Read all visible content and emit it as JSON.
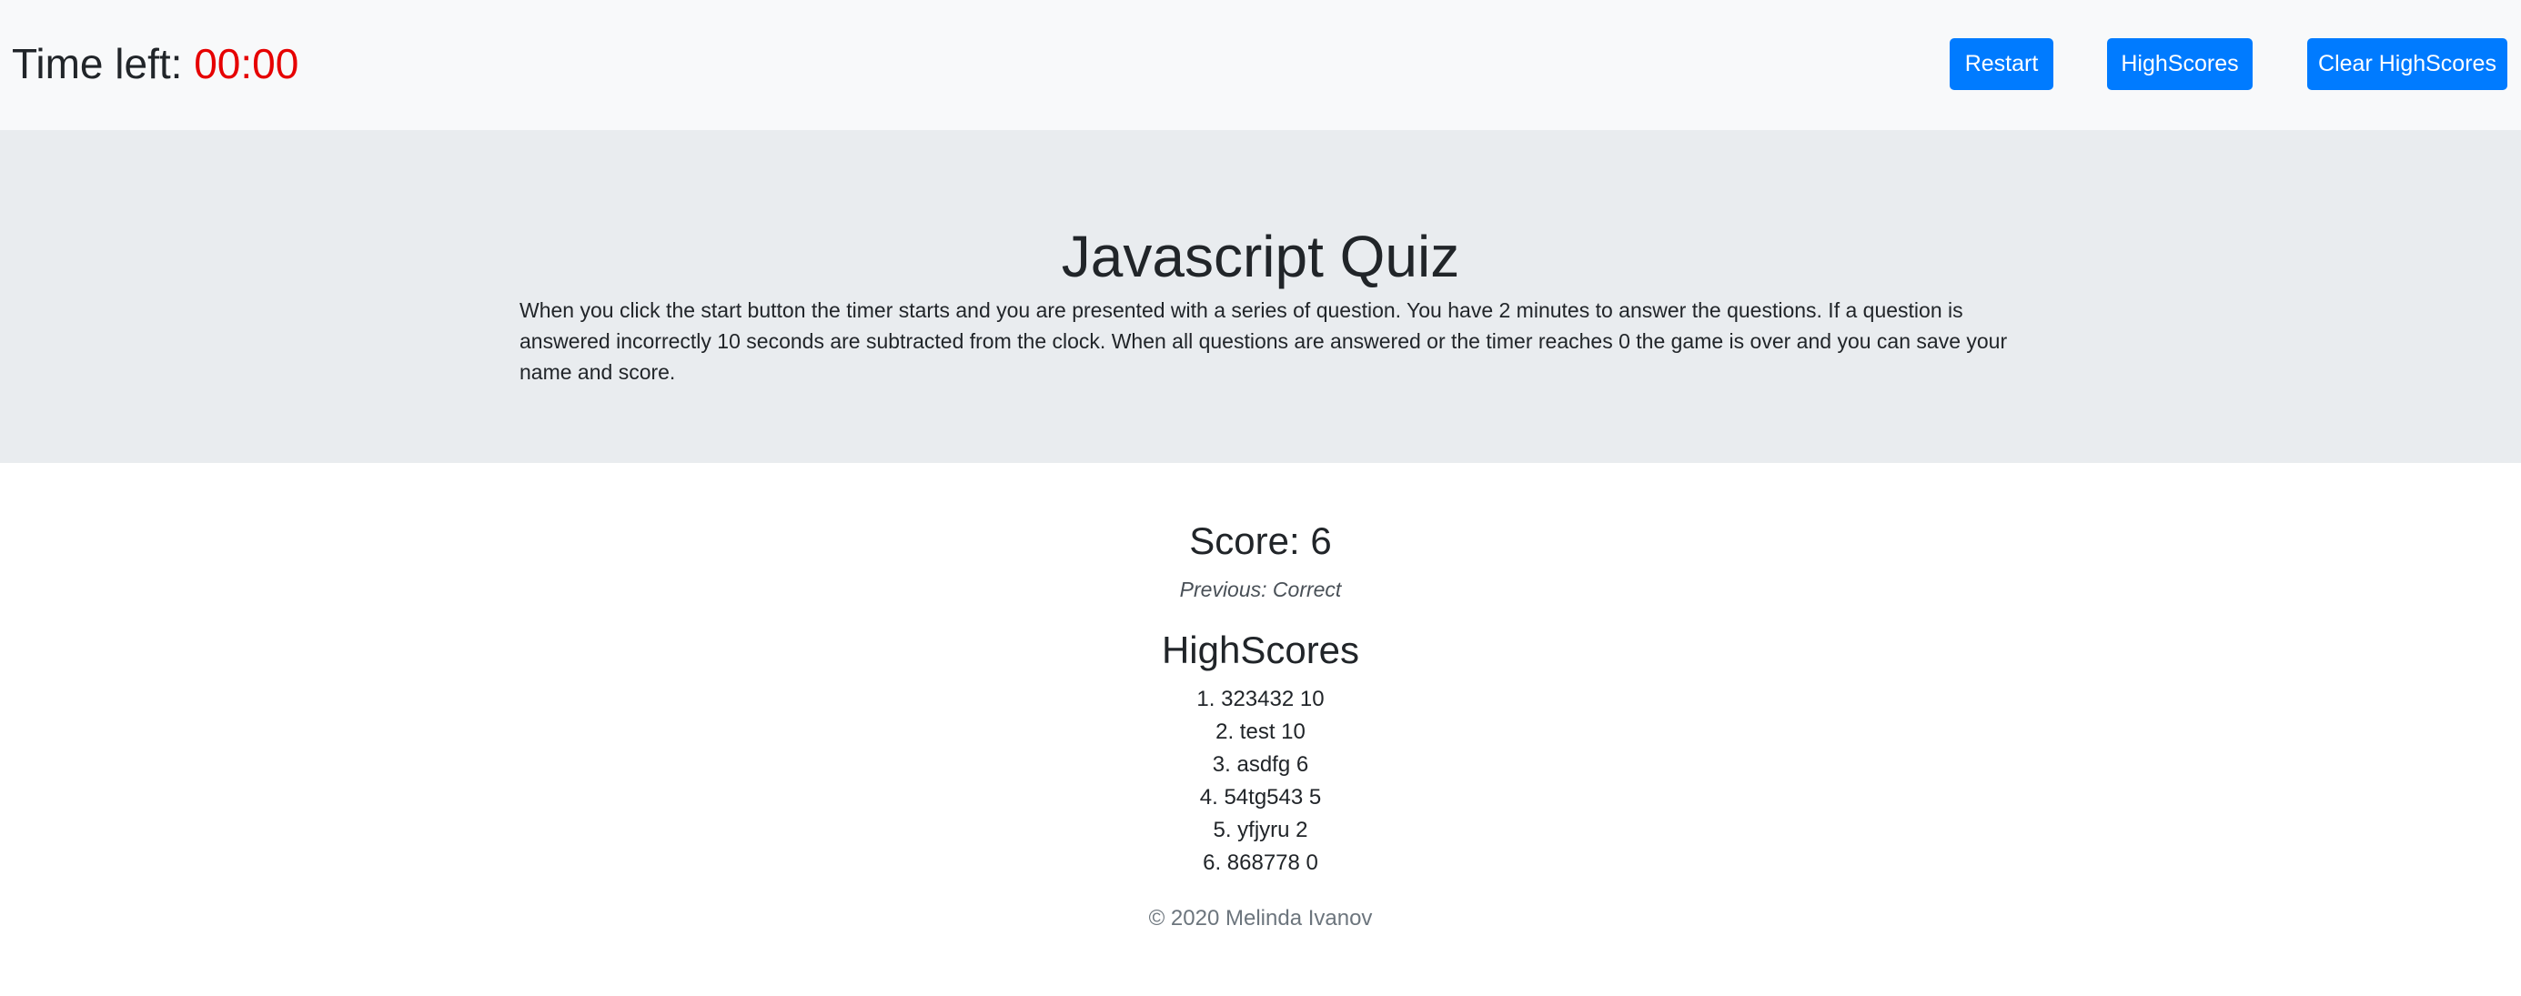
{
  "navbar": {
    "timer_label": "Time left:",
    "timer_value": "00:00",
    "timer_color": "#e60000",
    "buttons": {
      "restart": "Restart",
      "highscores": "HighScores",
      "clear_highscores": "Clear HighScores"
    },
    "button_color": "#007bff"
  },
  "jumbotron": {
    "title": "Javascript Quiz",
    "description": "When you click the start button the timer starts and you are presented with a series of question. You have 2 minutes to answer the questions. If a question is answered incorrectly 10 seconds are subtracted from the clock. When all questions are answered or the timer reaches 0 the game is over and you can save your name and score."
  },
  "results": {
    "score_label": "Score: 6",
    "previous": "Previous: Correct",
    "highscores_title": "HighScores",
    "highscores": [
      "1. 323432 10",
      "2. test 10",
      "3. asdfg 6",
      "4. 54tg543 5",
      "5. yfjyru 2",
      "6. 868778 0"
    ]
  },
  "footer": {
    "text": "© 2020 Melinda Ivanov"
  }
}
